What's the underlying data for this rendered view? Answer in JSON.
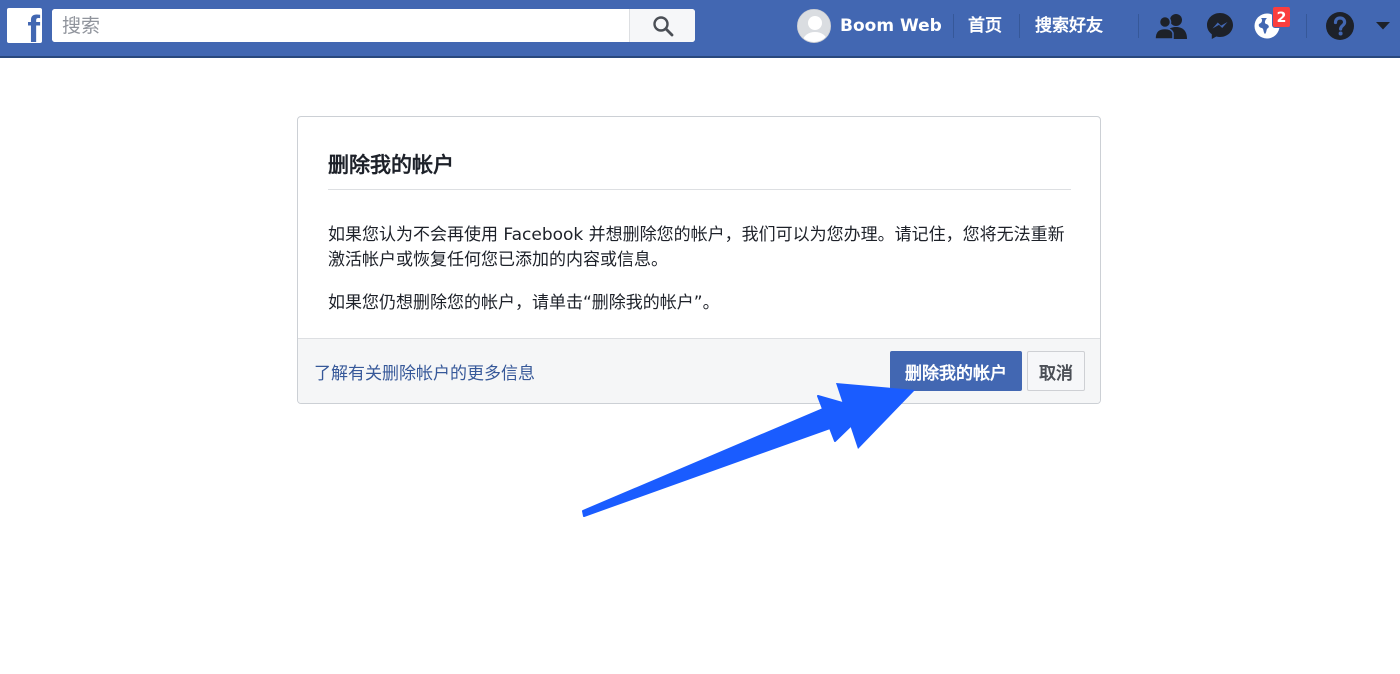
{
  "colors": {
    "brand_blue": "#4267b2",
    "link_blue": "#365899",
    "badge_red": "#fa3e3e",
    "annotation_arrow": "#1a5cff"
  },
  "header": {
    "logo_letter": "f",
    "search_placeholder": "搜索",
    "profile_name": "Boom Web",
    "nav_home": "首页",
    "nav_find_friends": "搜索好友",
    "notification_count": "2",
    "icons": [
      "facebook-logo",
      "search-icon",
      "avatar",
      "friend-requests-icon",
      "messenger-icon",
      "notifications-globe-icon",
      "help-icon",
      "caret-down-icon"
    ]
  },
  "dialog": {
    "title": "删除我的帐户",
    "paragraph1": "如果您认为不会再使用 Facebook 并想删除您的帐户，我们可以为您办理。请记住，您将无法重新激活帐户或恢复任何您已添加的内容或信息。",
    "paragraph2": "如果您仍想删除您的帐户，请单击“删除我的帐户”。",
    "learn_more_link": "了解有关删除帐户的更多信息",
    "delete_button": "删除我的帐户",
    "cancel_button": "取消"
  }
}
